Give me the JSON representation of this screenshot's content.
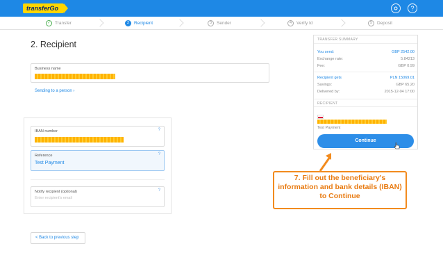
{
  "brand": {
    "logo_text": "transferGo"
  },
  "header": {
    "settings_icon": "gear-icon",
    "help_icon": "question-circle-icon",
    "help_glyph": "?"
  },
  "steps": [
    {
      "num": "✓",
      "label": "Transfer",
      "state": "done"
    },
    {
      "num": "2",
      "label": "Recipient",
      "state": "active"
    },
    {
      "num": "3",
      "label": "Sender",
      "state": "pending"
    },
    {
      "num": "4",
      "label": "Verify Id",
      "state": "pending"
    },
    {
      "num": "5",
      "label": "Deposit",
      "state": "pending"
    }
  ],
  "page_title": "2. Recipient",
  "business": {
    "label": "Business name",
    "value_redacted": true
  },
  "sending_link": "Sending to a person ›",
  "iban": {
    "label": "IBAN number",
    "help": "?",
    "value_redacted": true
  },
  "reference": {
    "label": "Reference",
    "help": "?",
    "value": "Test Payment"
  },
  "notify": {
    "label": "Notify recipient (optional)",
    "help": "?",
    "placeholder": "Enter recipient's email"
  },
  "back_button": "< Back to previous step",
  "summary": {
    "heading": "TRANSFER SUMMARY",
    "rows_top": [
      {
        "label": "You send:",
        "value": "GBP 2542.00",
        "highlight": true
      },
      {
        "label": "Exchange rate:",
        "value": "5.84213",
        "highlight": false
      },
      {
        "label": "Fee:",
        "value": "GBP 0.99",
        "highlight": false
      }
    ],
    "rows_bottom": [
      {
        "label": "Recipient gets",
        "value": "PLN 15069.01",
        "highlight": true
      },
      {
        "label": "Savings:",
        "value": "GBP 65.20",
        "highlight": false
      },
      {
        "label": "Delivered by:",
        "value": "2015-12-04 17:00",
        "highlight": false
      }
    ],
    "recipient_heading": "RECIPIENT",
    "recipient_flag": "poland-flag-icon",
    "recipient_reference": "Test Payment",
    "continue_label": "Continue"
  },
  "callout": {
    "text": "7. Fill out the beneficiary's information and bank details (IBAN) to Continue",
    "color": "#f28b1e"
  },
  "colors": {
    "brand_blue": "#1e88e5",
    "logo_yellow": "#ffd600",
    "accent_orange": "#f28b1e",
    "redaction": "#ffb300"
  }
}
